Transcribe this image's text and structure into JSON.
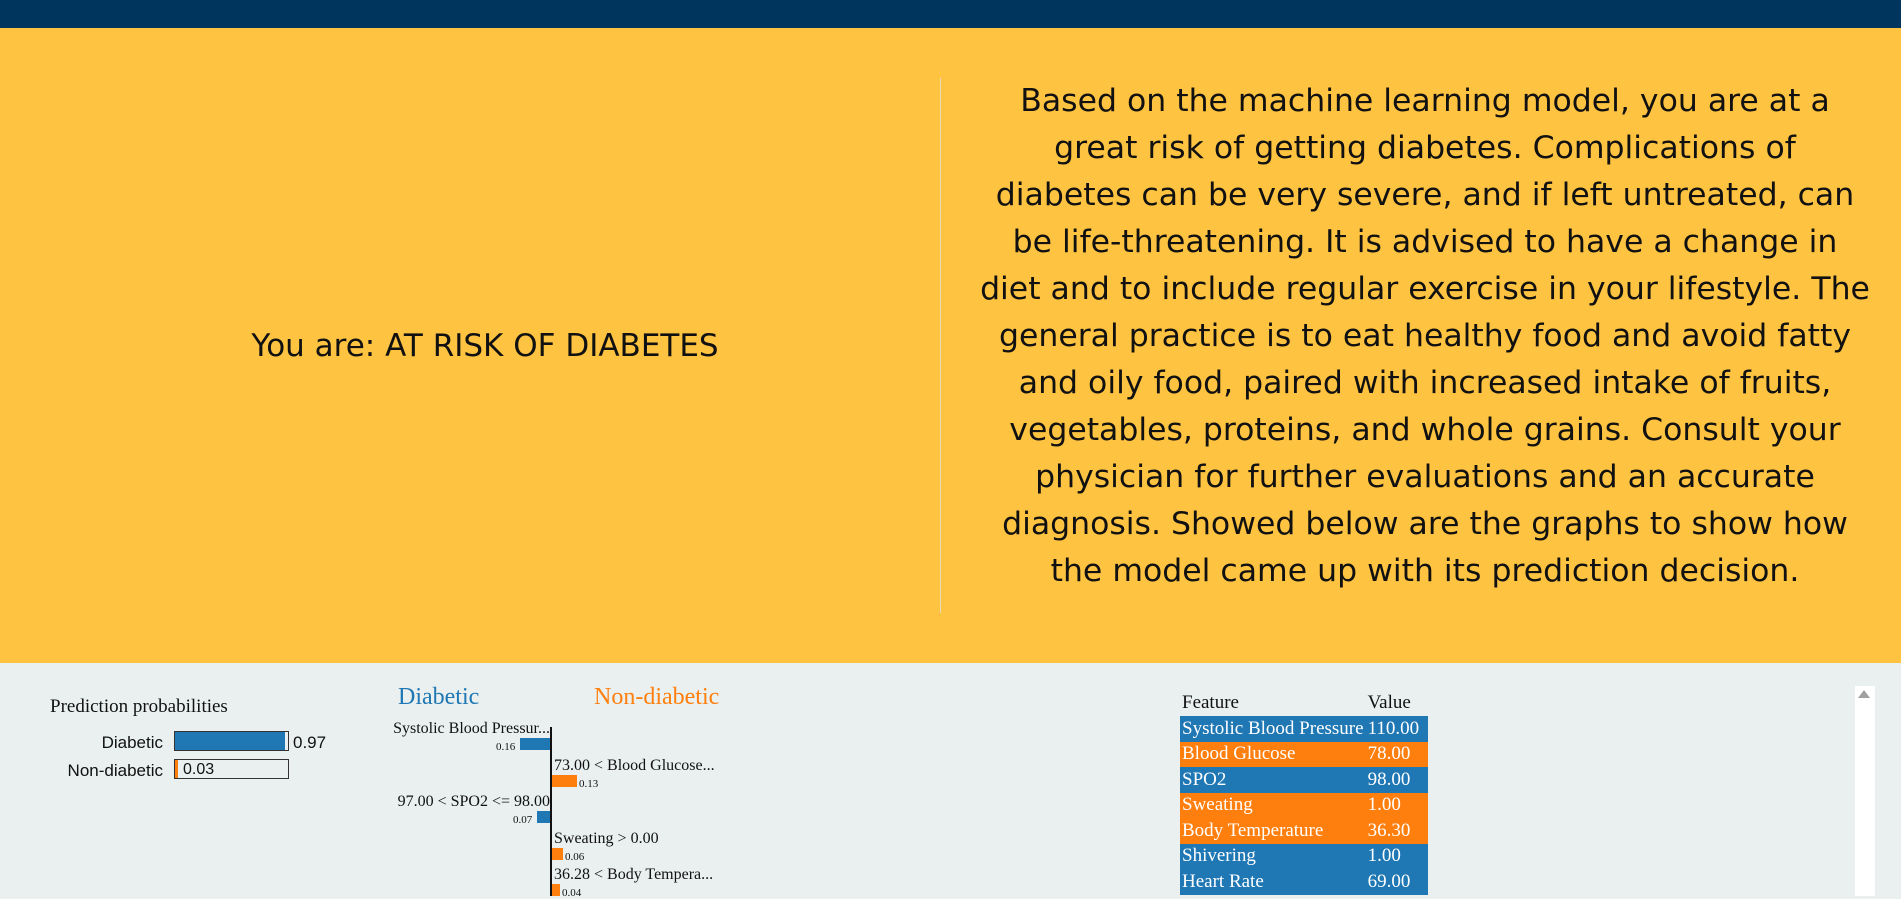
{
  "hero": {
    "status_text": "You are: AT RISK OF DIABETES",
    "advice_lines": [
      "Based on the machine learning model, you are at a",
      "great risk of getting diabetes. Complications of",
      "diabetes can be very severe, and if left untreated, can",
      "be life-threatening. It is advised to have a change in",
      "diet and to include regular exercise in your lifestyle. The",
      "general practice is to eat healthy food and avoid fatty",
      "and oily food, paired with increased intake of fruits,",
      "vegetables, proteins, and whole grains. Consult your",
      "physician for further evaluations and an accurate",
      "diagnosis. Showed below are the graphs to show how",
      "the model came up with its prediction decision."
    ]
  },
  "prediction": {
    "title": "Prediction probabilities",
    "rows": [
      {
        "label": "Diabetic",
        "value": "0.97",
        "fraction": 0.97
      },
      {
        "label": "Non-diabetic",
        "value": "0.03",
        "fraction": 0.03
      }
    ]
  },
  "explanation": {
    "left_heading": "Diabetic",
    "right_heading": "Non-diabetic",
    "features": [
      {
        "label": "Systolic Blood Pressur...",
        "weight": "0.16",
        "side": "left",
        "magnitude": 0.16
      },
      {
        "label": "73.00 < Blood Glucose...",
        "weight": "0.13",
        "side": "right",
        "magnitude": 0.13
      },
      {
        "label": "97.00 < SPO2 <= 98.00",
        "weight": "0.07",
        "side": "left",
        "magnitude": 0.07
      },
      {
        "label": "Sweating > 0.00",
        "weight": "0.06",
        "side": "right",
        "magnitude": 0.06
      },
      {
        "label": "36.28 < Body Tempera...",
        "weight": "0.04",
        "side": "right",
        "magnitude": 0.04
      }
    ]
  },
  "feature_table": {
    "headers": [
      "Feature",
      "Value"
    ],
    "rows": [
      {
        "feature": "Systolic Blood Pressure",
        "value": "110.00",
        "class": "diabetic"
      },
      {
        "feature": "Blood Glucose",
        "value": "78.00",
        "class": "non-diabetic"
      },
      {
        "feature": "SPO2",
        "value": "98.00",
        "class": "diabetic"
      },
      {
        "feature": "Sweating",
        "value": "1.00",
        "class": "non-diabetic"
      },
      {
        "feature": "Body Temperature",
        "value": "36.30",
        "class": "non-diabetic"
      },
      {
        "feature": "Shivering",
        "value": "1.00",
        "class": "diabetic"
      },
      {
        "feature": "Heart Rate",
        "value": "69.00",
        "class": "diabetic"
      }
    ]
  },
  "colors": {
    "topbar": "#00355e",
    "hero_bg": "#fec340",
    "diabetic": "#1f77b4",
    "non_diabetic": "#ff7f0e"
  }
}
